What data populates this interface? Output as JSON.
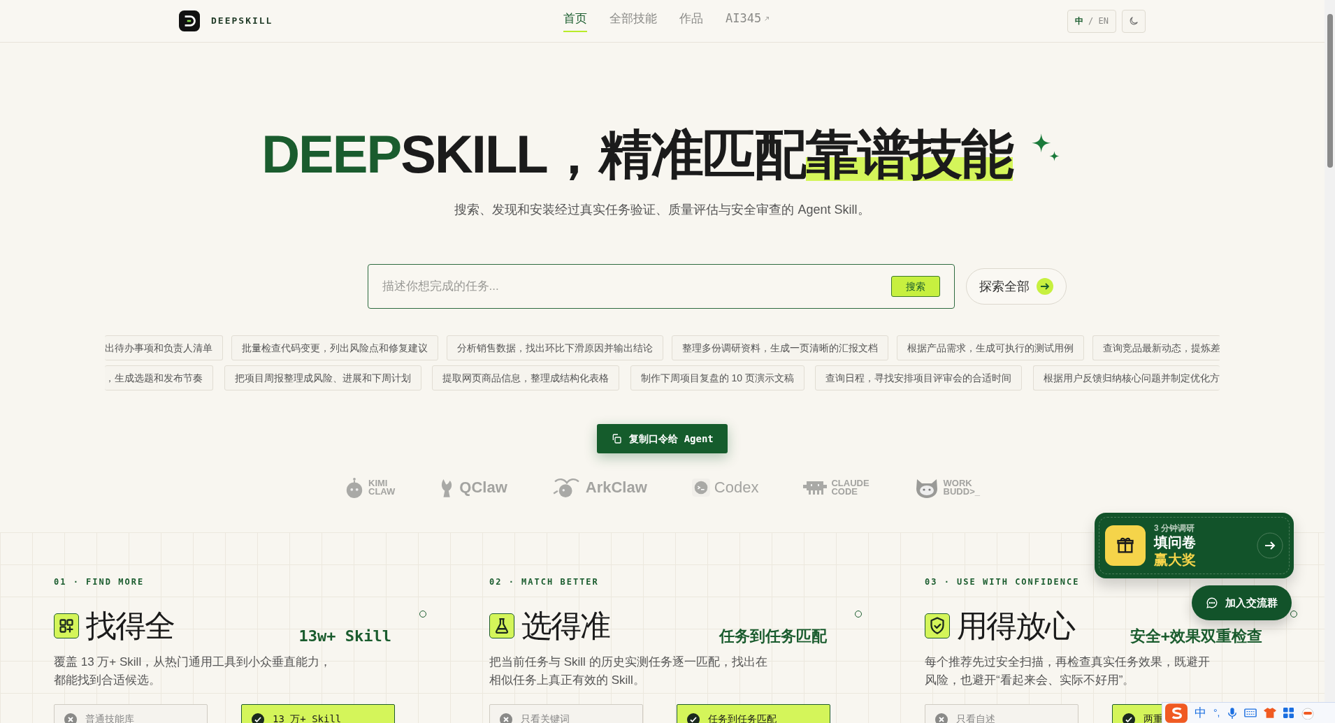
{
  "nav": {
    "brand": "DEEPSKILL",
    "links": [
      {
        "label": "首页",
        "selected": true,
        "external": false
      },
      {
        "label": "全部技能",
        "selected": false,
        "external": false
      },
      {
        "label": "作品",
        "selected": false,
        "external": false
      },
      {
        "label": "AI345",
        "selected": false,
        "external": true
      }
    ],
    "lang": {
      "active": "中",
      "sep": "/",
      "other": "EN"
    }
  },
  "hero": {
    "title_accent": "DEEP",
    "title_brand": "SKILL",
    "title_mid": "，精准匹配",
    "title_highlight": "靠谱技能",
    "subtitle": "搜索、发现和安装经过真实任务验证、质量评估与安全审查的 Agent Skill。"
  },
  "search": {
    "placeholder": "描述你想完成的任务...",
    "button": "搜索",
    "explore": "探索全部"
  },
  "chip_rows": [
    [
      "出待办事项和负责人清单",
      "批量检查代码变更，列出风险点和修复建议",
      "分析销售数据，找出环比下滑原因并输出结论",
      "整理多份调研资料，生成一页清晰的汇报文档",
      "根据产品需求，生成可执行的测试用例",
      "查询竞品最新动态，提炼差"
    ],
    [
      "，生成选题和发布节奏",
      "把项目周报整理成风险、进展和下周计划",
      "提取网页商品信息，整理成结构化表格",
      "制作下周项目复盘的 10 页演示文稿",
      "查询日程，寻找安排项目评审会的合适时间",
      "根据用户反馈归纳核心问题并制定优化方"
    ]
  ],
  "copy_button": "复制口令给 Agent",
  "logos": [
    {
      "kind": "kimi",
      "lines": [
        "KIMI",
        "CLAW"
      ]
    },
    {
      "kind": "qclaw",
      "lines": [
        "QClaw"
      ]
    },
    {
      "kind": "ark",
      "lines": [
        "ArkClaw"
      ]
    },
    {
      "kind": "codex",
      "lines": [
        "Codex"
      ]
    },
    {
      "kind": "claude",
      "lines": [
        "CLAUDE",
        "CODE"
      ]
    },
    {
      "kind": "work",
      "lines": [
        "WORK",
        "BUDD>_"
      ]
    }
  ],
  "features": [
    {
      "index": "01 · FIND MORE",
      "kind": "grid",
      "title": "找得全",
      "stat": "13w+ Skill",
      "description": "覆盖 13 万+ Skill，从热门通用工具到小众垂直能力，都能找到合适候选。",
      "pills": [
        {
          "label": "普通技能库",
          "kind": "no"
        },
        {
          "label": "13 万+ Skill",
          "kind": "yes"
        }
      ]
    },
    {
      "index": "02 · MATCH BETTER",
      "kind": "flask",
      "title": "选得准",
      "stat": "任务到任务匹配",
      "description": "把当前任务与 Skill 的历史实测任务逐一匹配，找出在相似任务上真正有效的 Skill。",
      "pills": [
        {
          "label": "只看关键词",
          "kind": "no"
        },
        {
          "label": "任务到任务匹配",
          "kind": "yes"
        }
      ]
    },
    {
      "index": "03 · USE WITH CONFIDENCE",
      "kind": "shield",
      "title": "用得放心",
      "stat": "安全+效果双重检查",
      "description": "每个推荐先过安全扫描，再检查真实任务效果，既避开风险，也避开“看起来会、实际不好用”。",
      "pills": [
        {
          "label": "只看自述",
          "kind": "no"
        },
        {
          "label": "两重",
          "kind": "yes"
        }
      ]
    }
  ],
  "survey": {
    "eyebrow": "3 分钟调研",
    "title": "填问卷",
    "accent": "赢大奖"
  },
  "chat_button": "加入交流群",
  "ime": {
    "mode": "中",
    "punct": "°,"
  }
}
